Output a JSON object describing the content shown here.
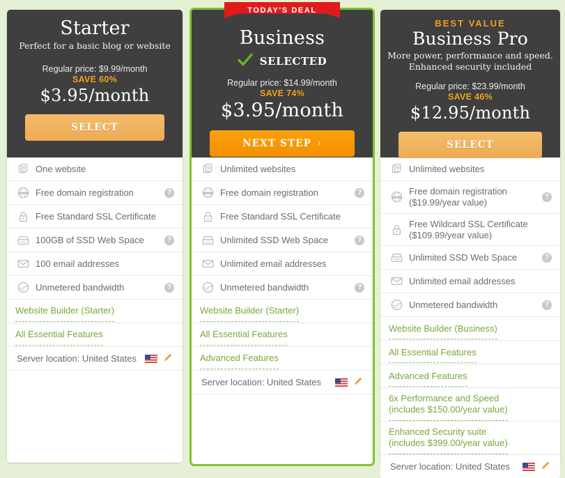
{
  "colors": {
    "page_bg": "#e6f0d4",
    "card_header_bg": "#3f3f3f",
    "accent_orange": "#f0a020",
    "cta_bright": "#fba00c",
    "ribbon_red": "#e01b1b",
    "highlight_green": "#7ec52a",
    "link_green": "#7aa63c"
  },
  "plans": [
    {
      "id": "starter",
      "badge": null,
      "ribbon": null,
      "name": "Starter",
      "tagline": "Perfect for a basic blog or website",
      "selected_label": null,
      "regular_price": "Regular price: $9.99/month",
      "save": "SAVE 60%",
      "price": "$3.95/month",
      "cta_label": "SELECT",
      "cta_chevron": null,
      "features": [
        {
          "icon": "pages-icon",
          "label": "One website",
          "help": false
        },
        {
          "icon": "www-globe-icon",
          "label": "Free domain registration",
          "help": true
        },
        {
          "icon": "lock-icon",
          "label": "Free Standard SSL Certificate",
          "help": false
        },
        {
          "icon": "drive-icon",
          "label": "100GB of SSD Web Space",
          "help": true
        },
        {
          "icon": "envelope-icon",
          "label": "100 email addresses",
          "help": false
        },
        {
          "icon": "bandwidth-globe-icon",
          "label": "Unmetered bandwidth",
          "help": true
        }
      ],
      "links": [
        "Website Builder (Starter)",
        "All Essential Features"
      ],
      "server_location": "Server location: United States"
    },
    {
      "id": "business",
      "badge": null,
      "ribbon": "TODAY'S DEAL",
      "name": "Business",
      "tagline": null,
      "selected_label": "SELECTED",
      "regular_price": "Regular price: $14.99/month",
      "save": "SAVE 74%",
      "price": "$3.95/month",
      "cta_label": "NEXT STEP",
      "cta_chevron": "›",
      "features": [
        {
          "icon": "pages-icon",
          "label": "Unlimited websites",
          "help": false
        },
        {
          "icon": "www-globe-icon",
          "label": "Free domain registration",
          "help": true
        },
        {
          "icon": "lock-icon",
          "label": "Free Standard SSL Certificate",
          "help": false
        },
        {
          "icon": "drive-icon",
          "label": "Unlimited SSD Web Space",
          "help": true
        },
        {
          "icon": "envelope-icon",
          "label": "Unlimited email addresses",
          "help": false
        },
        {
          "icon": "bandwidth-globe-icon",
          "label": "Unmetered bandwidth",
          "help": true
        }
      ],
      "links": [
        "Website Builder (Starter)",
        "All Essential Features",
        "Advanced Features"
      ],
      "server_location": "Server location: United States"
    },
    {
      "id": "business-pro",
      "badge": "BEST VALUE",
      "ribbon": null,
      "name": "Business Pro",
      "tagline": "More power, performance and speed. Enhanced security included",
      "selected_label": null,
      "regular_price": "Regular price: $23.99/month",
      "save": "SAVE 46%",
      "price": "$12.95/month",
      "cta_label": "SELECT",
      "cta_chevron": null,
      "features": [
        {
          "icon": "pages-icon",
          "label": "Unlimited websites",
          "sub": null,
          "help": false
        },
        {
          "icon": "www-globe-icon",
          "label": "Free domain registration",
          "sub": "($19.99/year value)",
          "help": true
        },
        {
          "icon": "lock-icon",
          "label": "Free Wildcard SSL Certificate",
          "sub": "($109.99/year value)",
          "help": false
        },
        {
          "icon": "drive-icon",
          "label": "Unlimited SSD Web Space",
          "sub": null,
          "help": true
        },
        {
          "icon": "envelope-icon",
          "label": "Unlimited email addresses",
          "sub": null,
          "help": false
        },
        {
          "icon": "bandwidth-globe-icon",
          "label": "Unmetered bandwidth",
          "sub": null,
          "help": true
        }
      ],
      "links": [
        "Website Builder (Business)",
        "All Essential Features",
        "Advanced Features"
      ],
      "value_links": [
        {
          "label": "6x Performance and Speed",
          "sub": "(includes $150.00/year value)"
        },
        {
          "label": "Enhanced Security suite",
          "sub": "(includes $399.00/year value)"
        }
      ],
      "server_location": "Server location: United States"
    }
  ]
}
